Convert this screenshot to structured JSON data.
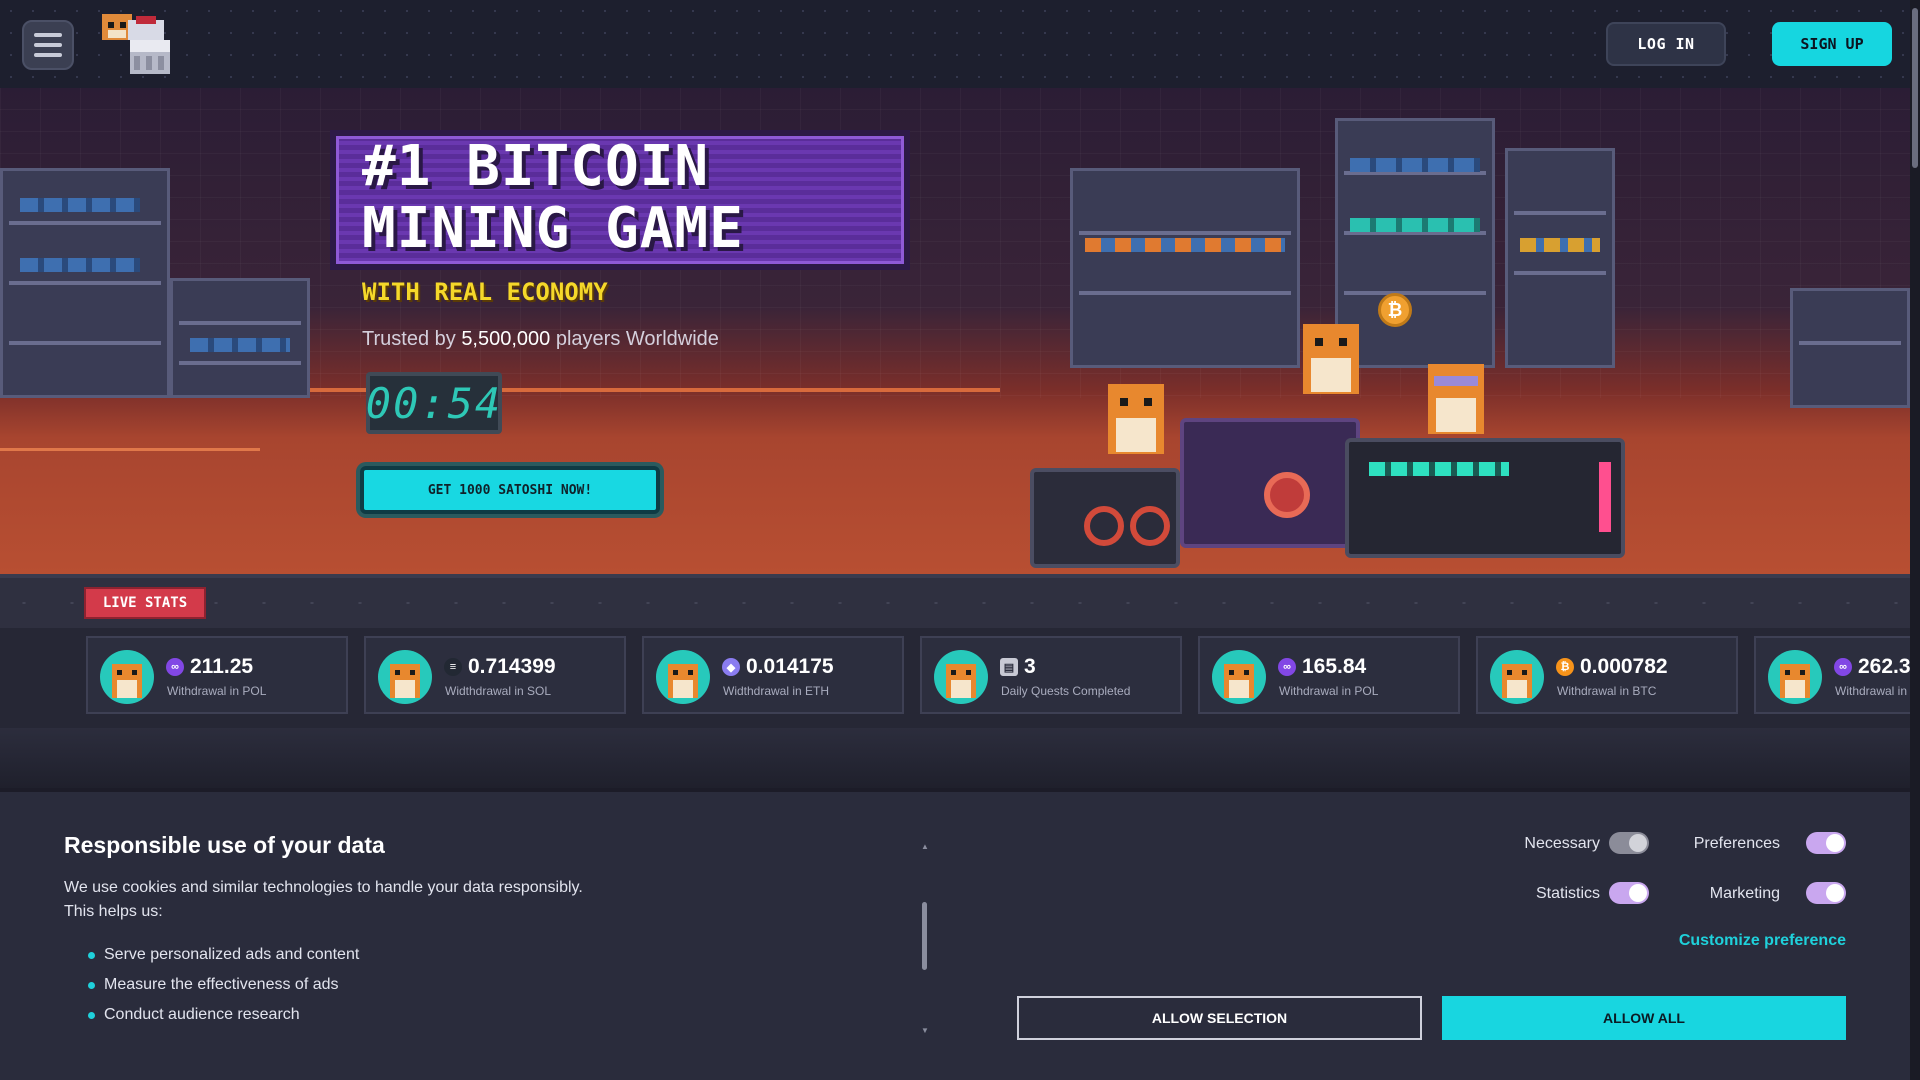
{
  "header": {
    "login_label": "LOG IN",
    "signup_label": "SIGN UP"
  },
  "hero": {
    "title_line1": "#1 BITCOIN",
    "title_line2": "MINING GAME",
    "subtitle": "WITH REAL ECONOMY",
    "trusted_prefix": "Trusted by",
    "trusted_count": "5,500,000",
    "trusted_suffix": "players Worldwide",
    "timer": "00:54",
    "cta_label": "GET 1000 SATOSHI NOW!"
  },
  "live_stats": {
    "label": "LIVE STATS",
    "items": [
      {
        "value": "211.25",
        "label": "Withdrawal in POL",
        "coin": "pol-icon",
        "coin_color": "#8247e5"
      },
      {
        "value": "0.714399",
        "label": "Widthdrawal in SOL",
        "coin": "sol-icon",
        "coin_color": "#222833"
      },
      {
        "value": "0.014175",
        "label": "Widthdrawal in ETH",
        "coin": "eth-icon",
        "coin_color": "#8a7cf0"
      },
      {
        "value": "3",
        "label": "Daily Quests Completed",
        "coin": "quest-icon",
        "coin_color": "#c8c9d4"
      },
      {
        "value": "165.84",
        "label": "Withdrawal in POL",
        "coin": "pol-icon",
        "coin_color": "#8247e5"
      },
      {
        "value": "0.000782",
        "label": "Withdrawal in BTC",
        "coin": "btc-icon",
        "coin_color": "#f7931a"
      },
      {
        "value": "262.3",
        "label": "Withdrawal in",
        "coin": "pol-icon",
        "coin_color": "#8247e5"
      }
    ]
  },
  "cookie": {
    "title": "Responsible use of your data",
    "desc_line1": "We use cookies and similar technologies to handle your data responsibly.",
    "desc_line2": "This helps us:",
    "list": [
      "Serve personalized ads and content",
      "Measure the effectiveness of ads",
      "Conduct audience research"
    ],
    "prefs": {
      "necessary": "Necessary",
      "preferences": "Preferences",
      "statistics": "Statistics",
      "marketing": "Marketing"
    },
    "customize_label": "Customize preference",
    "allow_selection_label": "ALLOW SELECTION",
    "allow_all_label": "ALLOW ALL"
  },
  "colors": {
    "accent": "#18d6e0",
    "live_stats": "#d33a4a",
    "subtitle_yellow": "#f5d82a"
  }
}
